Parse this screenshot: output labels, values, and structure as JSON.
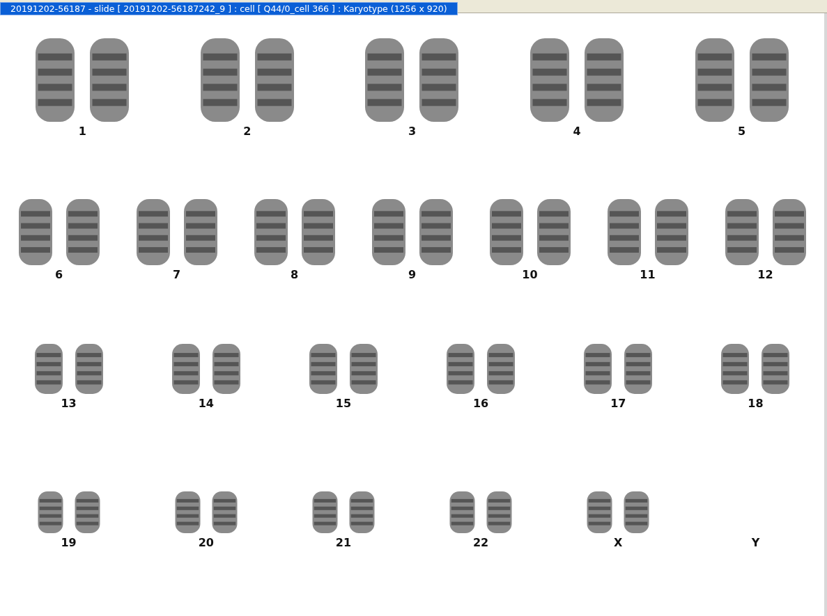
{
  "window": {
    "title": "20191202-56187 - slide [  20191202-56187242_9 ] : cell [ Q44/0_cell 366 ] : Karyotype  (1256 x 920)"
  },
  "karyogram": {
    "rows": [
      {
        "items": [
          {
            "label": "1",
            "kind": "pair"
          },
          {
            "label": "2",
            "kind": "pair"
          },
          {
            "label": "3",
            "kind": "pair"
          },
          {
            "label": "4",
            "kind": "pair"
          },
          {
            "label": "5",
            "kind": "pair"
          }
        ]
      },
      {
        "items": [
          {
            "label": "6",
            "kind": "pair"
          },
          {
            "label": "7",
            "kind": "pair"
          },
          {
            "label": "8",
            "kind": "pair"
          },
          {
            "label": "9",
            "kind": "pair"
          },
          {
            "label": "10",
            "kind": "pair"
          },
          {
            "label": "11",
            "kind": "pair"
          },
          {
            "label": "12",
            "kind": "pair"
          }
        ]
      },
      {
        "items": [
          {
            "label": "13",
            "kind": "pair"
          },
          {
            "label": "14",
            "kind": "pair"
          },
          {
            "label": "15",
            "kind": "pair"
          },
          {
            "label": "16",
            "kind": "pair"
          },
          {
            "label": "17",
            "kind": "pair"
          },
          {
            "label": "18",
            "kind": "pair"
          }
        ]
      },
      {
        "items": [
          {
            "label": "19",
            "kind": "pair"
          },
          {
            "label": "20",
            "kind": "pair"
          },
          {
            "label": "21",
            "kind": "pair"
          },
          {
            "label": "22",
            "kind": "pair"
          },
          {
            "label": "X",
            "kind": "pair"
          },
          {
            "label": "Y",
            "kind": "empty"
          }
        ]
      }
    ]
  }
}
